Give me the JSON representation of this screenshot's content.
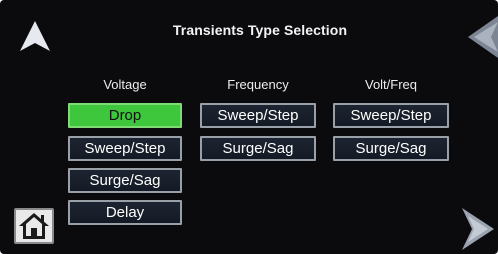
{
  "title": "Transients Type Selection",
  "nav": {
    "up_icon": "up-arrow-icon",
    "left_icon": "left-arrow-icon",
    "right_icon": "right-arrow-icon",
    "home_icon": "home-icon"
  },
  "columns": {
    "voltage": {
      "header": "Voltage",
      "buttons": [
        "Drop",
        "Sweep/Step",
        "Surge/Sag",
        "Delay"
      ],
      "selected": "Drop"
    },
    "frequency": {
      "header": "Frequency",
      "buttons": [
        "Sweep/Step",
        "Surge/Sag"
      ]
    },
    "voltfreq": {
      "header": "Volt/Freq",
      "buttons": [
        "Sweep/Step",
        "Surge/Sag"
      ]
    }
  },
  "colors": {
    "background": "#0b0b0d",
    "selected": "#3ec63c",
    "button": "#1d2431",
    "arrow": "#dfe3ea"
  }
}
